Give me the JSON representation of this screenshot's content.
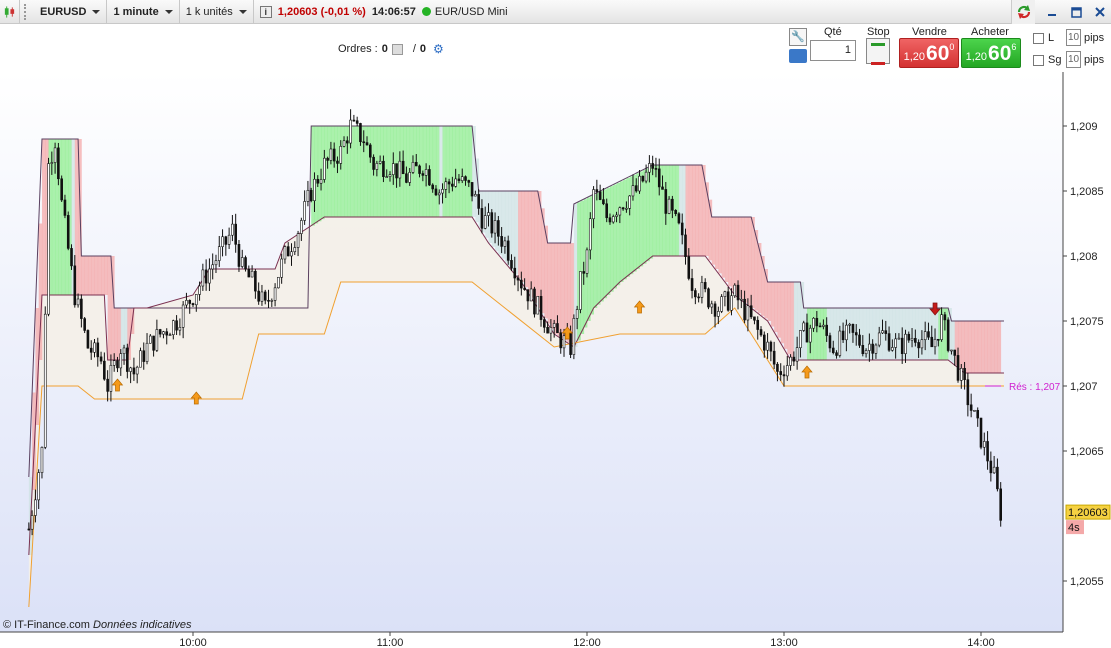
{
  "toolbar": {
    "symbol": "EURUSD",
    "timeframe": "1 minute",
    "units": "1 k unités",
    "quote": "1,20603 (-0,01 %)",
    "time": "14:06:57",
    "instrument": "EUR/USD Mini",
    "info_glyph": "i"
  },
  "orders": {
    "label": "Ordres :",
    "count_a": "0",
    "separator": "/",
    "count_b": "0"
  },
  "trade_panel": {
    "qty_label": "Qté",
    "qty_value": "1",
    "stop_label": "Stop",
    "sell_label": "Vendre",
    "buy_label": "Acheter",
    "sell_prefix": "1,20",
    "sell_big": "60",
    "sell_sup": "0",
    "buy_prefix": "1,20",
    "buy_big": "60",
    "buy_sup": "6",
    "l_label": "L",
    "sg_label": "Sg",
    "l_pips": "10",
    "sg_pips": "10",
    "pips_label": "pips"
  },
  "footer": {
    "credit": "© IT-Finance.com",
    "note": "Données indicatives"
  },
  "colors": {
    "bull_fill": "#90ee90",
    "bear_fill": "#f4a9a9",
    "neutral_fill": "#cfe3e3",
    "lower_band": "#f0a030",
    "resistance": "#d020d0",
    "last_price_bg": "#f5d142",
    "sell": "#d43232",
    "buy": "#23a623"
  },
  "icons": [
    "candlestick-icon",
    "info-icon",
    "live-status-icon",
    "refresh-icon",
    "minimize-icon",
    "restore-icon",
    "close-icon",
    "orders-icon",
    "gear-icon",
    "wrench-icon",
    "keyboard-icon",
    "stop-icon",
    "up-arrow-icon",
    "down-arrow-icon"
  ],
  "chart_data": {
    "type": "candlestick",
    "title": "",
    "xlabel": "",
    "ylabel": "",
    "x_ticks": [
      "10:00",
      "11:00",
      "12:00",
      "13:00",
      "14:00"
    ],
    "y_ticks": [
      "1,209",
      "1,2085",
      "1,208",
      "1,2075",
      "1,207",
      "1,2065",
      "1,2055"
    ],
    "xlim": [
      "09:10",
      "14:25"
    ],
    "ylim": [
      1.205,
      1.2095
    ],
    "last_price_label": "1,20603",
    "last_price": 1.20603,
    "countdown": "4s",
    "resistance_label": "Rés : 1,207",
    "resistance": 1.207,
    "close_path": [
      [
        "09:10",
        1.2059
      ],
      [
        "09:14",
        1.2065
      ],
      [
        "09:16",
        1.2087
      ],
      [
        "09:18",
        1.2089
      ],
      [
        "09:20",
        1.2084
      ],
      [
        "09:24",
        1.2077
      ],
      [
        "09:28",
        1.2073
      ],
      [
        "09:32",
        1.2072
      ],
      [
        "09:34",
        1.207
      ],
      [
        "09:38",
        1.2073
      ],
      [
        "09:42",
        1.2071
      ],
      [
        "09:46",
        1.2073
      ],
      [
        "09:50",
        1.2074
      ],
      [
        "09:55",
        1.2075
      ],
      [
        "10:00",
        1.2077
      ],
      [
        "10:05",
        1.2079
      ],
      [
        "10:10",
        1.2081
      ],
      [
        "10:12",
        1.2082
      ],
      [
        "10:15",
        1.2079
      ],
      [
        "10:18",
        1.2078
      ],
      [
        "10:22",
        1.2076
      ],
      [
        "10:25",
        1.2078
      ],
      [
        "10:28",
        1.208
      ],
      [
        "10:32",
        1.2082
      ],
      [
        "10:36",
        1.2085
      ],
      [
        "10:40",
        1.2087
      ],
      [
        "10:45",
        1.2088
      ],
      [
        "10:48",
        1.209
      ],
      [
        "10:52",
        1.2089
      ],
      [
        "10:55",
        1.2087
      ],
      [
        "11:00",
        1.2087
      ],
      [
        "11:05",
        1.2086
      ],
      [
        "11:10",
        1.2087
      ],
      [
        "11:15",
        1.2085
      ],
      [
        "11:20",
        1.2086
      ],
      [
        "11:25",
        1.2085
      ],
      [
        "11:28",
        1.2083
      ],
      [
        "11:32",
        1.2082
      ],
      [
        "11:35",
        1.2081
      ],
      [
        "11:40",
        1.2078
      ],
      [
        "11:45",
        1.2076
      ],
      [
        "11:50",
        1.2074
      ],
      [
        "11:55",
        1.2073
      ],
      [
        "11:58",
        1.2078
      ],
      [
        "12:00",
        1.208
      ],
      [
        "12:02",
        1.2085
      ],
      [
        "12:06",
        1.2083
      ],
      [
        "12:10",
        1.2084
      ],
      [
        "12:15",
        1.2085
      ],
      [
        "12:20",
        1.2087
      ],
      [
        "12:24",
        1.2084
      ],
      [
        "12:28",
        1.2082
      ],
      [
        "12:32",
        1.2078
      ],
      [
        "12:36",
        1.2077
      ],
      [
        "12:40",
        1.2076
      ],
      [
        "12:45",
        1.2077
      ],
      [
        "12:50",
        1.2075
      ],
      [
        "12:55",
        1.2073
      ],
      [
        "12:58",
        1.2071
      ],
      [
        "13:02",
        1.2072
      ],
      [
        "13:06",
        1.2074
      ],
      [
        "13:10",
        1.2075
      ],
      [
        "13:15",
        1.2073
      ],
      [
        "13:20",
        1.2074
      ],
      [
        "13:25",
        1.2073
      ],
      [
        "13:30",
        1.2074
      ],
      [
        "13:35",
        1.2073
      ],
      [
        "13:40",
        1.2074
      ],
      [
        "13:45",
        1.2073
      ],
      [
        "13:48",
        1.2075
      ],
      [
        "13:52",
        1.2072
      ],
      [
        "13:56",
        1.2069
      ],
      [
        "14:00",
        1.2066
      ],
      [
        "14:04",
        1.2063
      ],
      [
        "14:06",
        1.20603
      ]
    ],
    "upper_band": [
      [
        "09:10",
        1.2063
      ],
      [
        "09:14",
        1.2089
      ],
      [
        "09:25",
        1.2089
      ],
      [
        "09:26",
        1.208
      ],
      [
        "09:35",
        1.208
      ],
      [
        "09:36",
        1.2076
      ],
      [
        "10:35",
        1.2076
      ],
      [
        "10:36",
        1.209
      ],
      [
        "11:25",
        1.209
      ],
      [
        "11:27",
        1.2085
      ],
      [
        "11:45",
        1.2085
      ],
      [
        "11:48",
        1.2081
      ],
      [
        "11:55",
        1.2081
      ],
      [
        "11:56",
        1.2084
      ],
      [
        "12:20",
        1.2087
      ],
      [
        "12:35",
        1.2087
      ],
      [
        "12:38",
        1.2083
      ],
      [
        "12:50",
        1.2083
      ],
      [
        "12:55",
        1.2078
      ],
      [
        "13:05",
        1.2078
      ],
      [
        "13:06",
        1.2076
      ],
      [
        "13:50",
        1.2076
      ],
      [
        "13:51",
        1.2075
      ],
      [
        "14:07",
        1.2075
      ]
    ],
    "middle_band": [
      [
        "09:10",
        1.2057
      ],
      [
        "09:14",
        1.2077
      ],
      [
        "09:33",
        1.2077
      ],
      [
        "09:34",
        1.2072
      ],
      [
        "09:40",
        1.2072
      ],
      [
        "09:42",
        1.2076
      ],
      [
        "09:46",
        1.2076
      ],
      [
        "10:00",
        1.2077
      ],
      [
        "10:05",
        1.2079
      ],
      [
        "10:25",
        1.2079
      ],
      [
        "10:28",
        1.2081
      ],
      [
        "10:40",
        1.2083
      ],
      [
        "11:00",
        1.2083
      ],
      [
        "11:25",
        1.2083
      ],
      [
        "11:30",
        1.2081
      ],
      [
        "11:40",
        1.2078
      ],
      [
        "11:50",
        1.2074
      ],
      [
        "11:56",
        1.2073
      ],
      [
        "12:02",
        1.2076
      ],
      [
        "12:10",
        1.2078
      ],
      [
        "12:20",
        1.208
      ],
      [
        "12:36",
        1.208
      ],
      [
        "12:45",
        1.2077
      ],
      [
        "12:55",
        1.2075
      ],
      [
        "13:02",
        1.2072
      ],
      [
        "13:06",
        1.2072
      ],
      [
        "13:50",
        1.2072
      ],
      [
        "13:55",
        1.2071
      ],
      [
        "14:07",
        1.2071
      ]
    ],
    "lower_band": [
      [
        "09:10",
        1.2053
      ],
      [
        "09:14",
        1.207
      ],
      [
        "09:25",
        1.207
      ],
      [
        "09:30",
        1.2069
      ],
      [
        "10:15",
        1.2069
      ],
      [
        "10:20",
        1.2074
      ],
      [
        "10:40",
        1.2074
      ],
      [
        "10:45",
        1.2078
      ],
      [
        "11:25",
        1.2078
      ],
      [
        "11:30",
        1.2077
      ],
      [
        "11:50",
        1.2073
      ],
      [
        "12:10",
        1.2074
      ],
      [
        "12:20",
        1.2074
      ],
      [
        "12:36",
        1.2074
      ],
      [
        "12:45",
        1.2076
      ],
      [
        "13:00",
        1.207
      ],
      [
        "13:50",
        1.207
      ],
      [
        "14:07",
        1.207
      ]
    ],
    "signals": [
      {
        "time": "09:37",
        "price": 1.207,
        "dir": "up"
      },
      {
        "time": "10:01",
        "price": 1.2069,
        "dir": "up"
      },
      {
        "time": "11:54",
        "price": 1.2074,
        "dir": "up"
      },
      {
        "time": "12:16",
        "price": 1.2076,
        "dir": "up"
      },
      {
        "time": "13:07",
        "price": 1.2071,
        "dir": "up"
      },
      {
        "time": "13:46",
        "price": 1.2076,
        "dir": "down"
      }
    ],
    "grid": false,
    "legend": "none"
  }
}
